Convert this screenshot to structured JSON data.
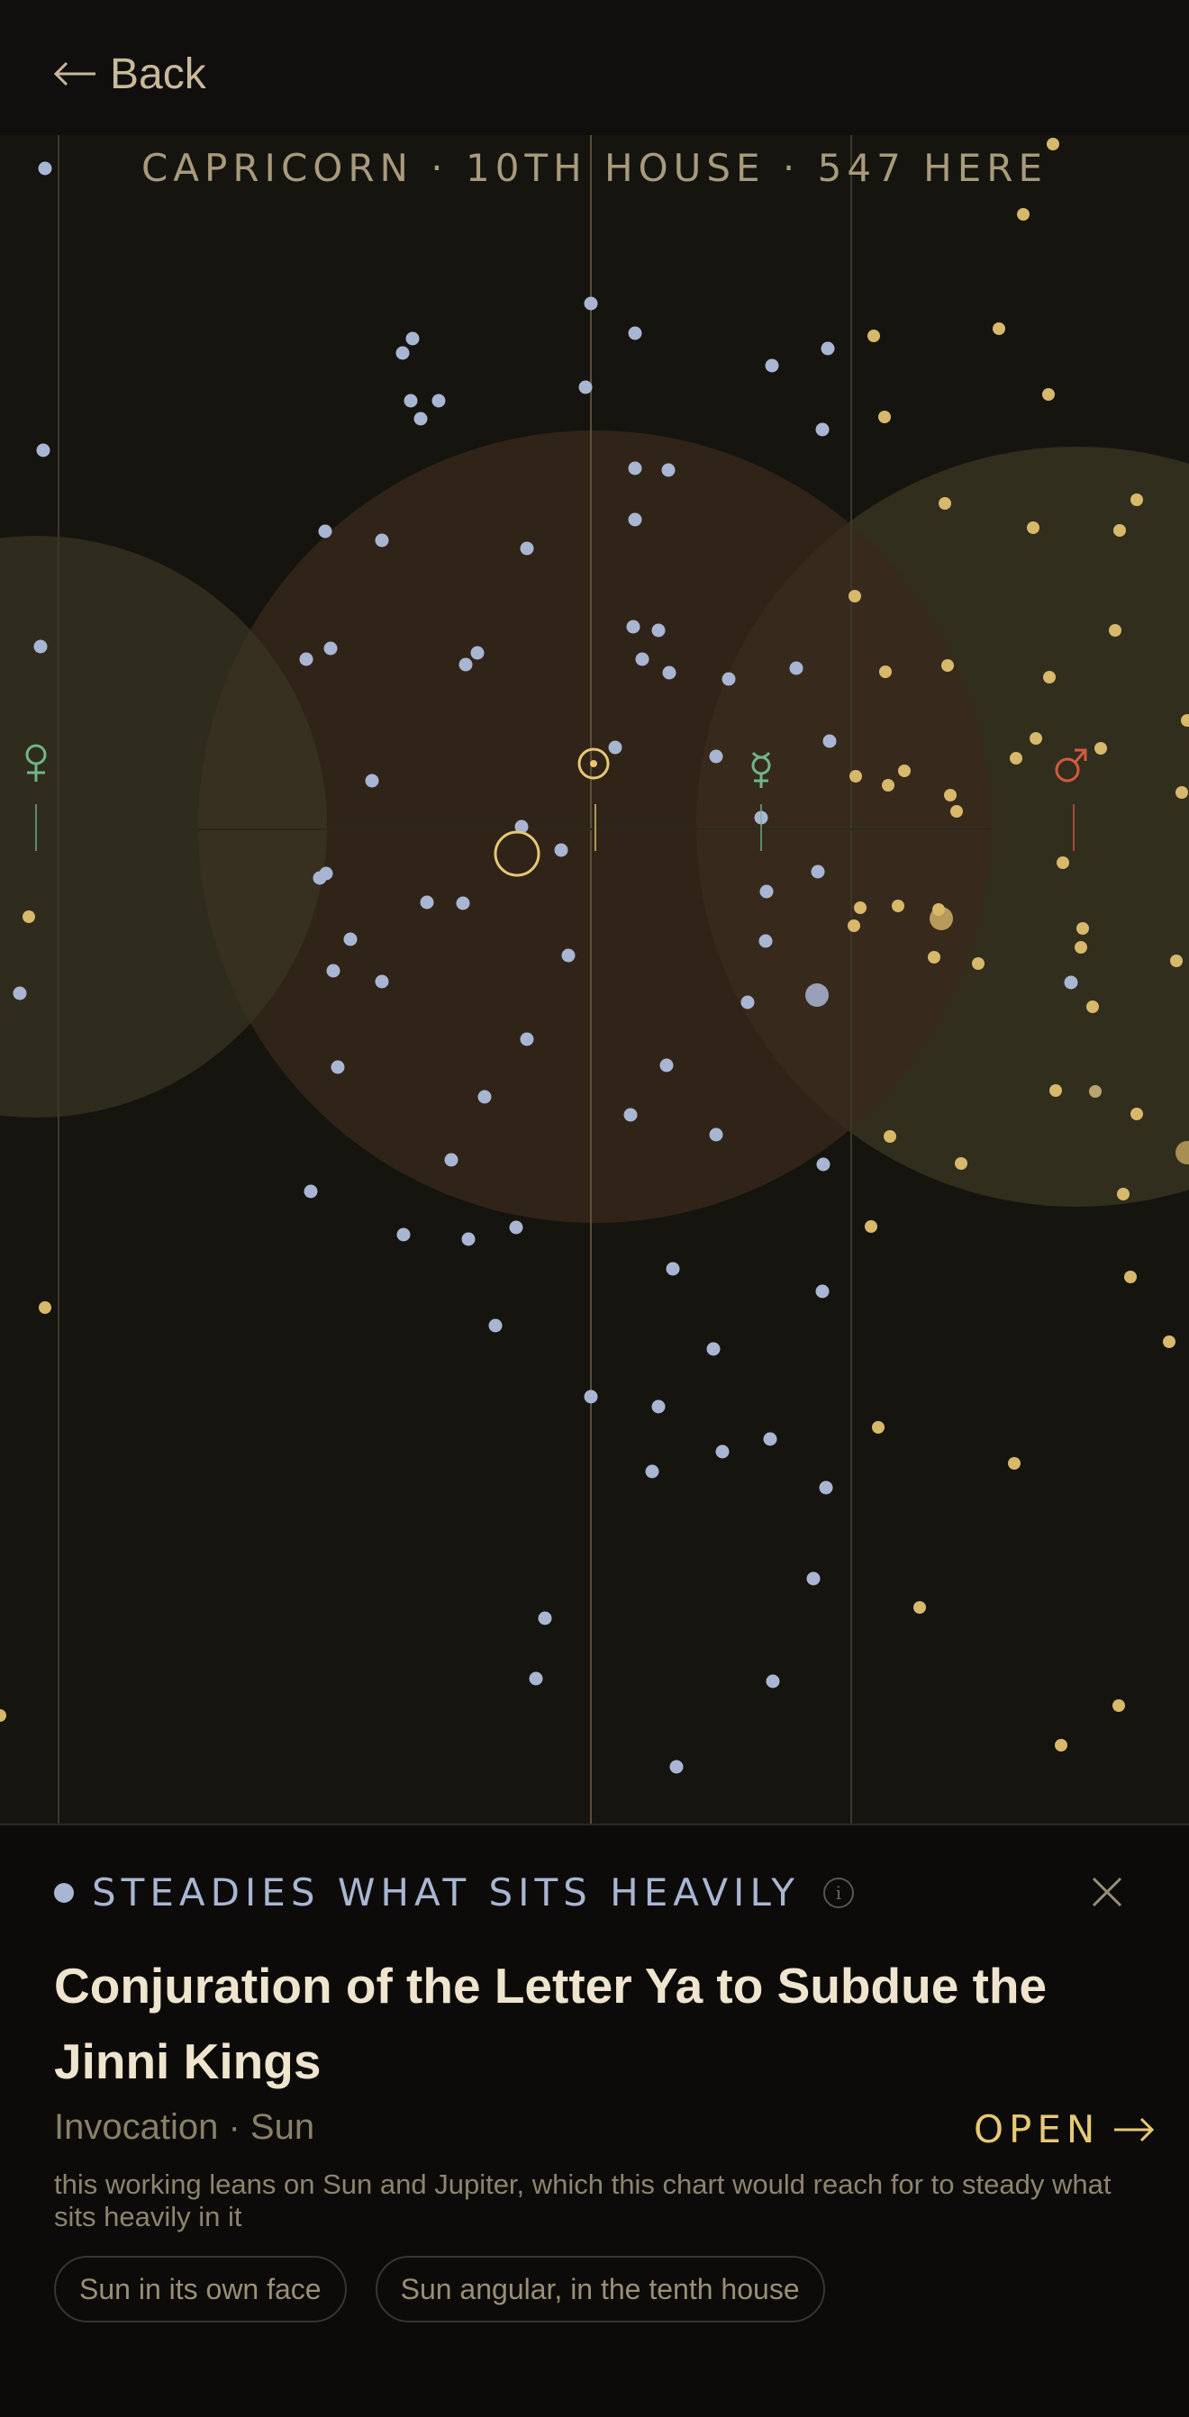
{
  "nav": {
    "back_label": "Back"
  },
  "location_label": "CAPRICORN · 10TH HOUSE · 547 HERE",
  "planets": [
    {
      "name": "venus-glyph",
      "glyph": "♀",
      "color": "#6fb58a"
    },
    {
      "name": "mercury-glyph",
      "glyph": "☿",
      "color": "#6fb58a"
    },
    {
      "name": "sun-glyph",
      "glyph": "☉",
      "color": "#e7c873"
    },
    {
      "name": "mars-glyph",
      "glyph": "♂",
      "color": "#d45a3f"
    }
  ],
  "colors": {
    "star_blue": "#a9b6d3",
    "star_gold": "#d8b86a",
    "accent_gold": "#e7c873",
    "title": "#efe4cd"
  },
  "card": {
    "verdict": "STEADIES WHAT SITS HEAVILY",
    "title": "Conjuration of the Letter Ya to Subdue the Jinni Kings",
    "subtitle": "Invocation · Sun",
    "open_label": "OPEN",
    "description": "this working leans on Sun and Jupiter, which this chart would reach for to steady what sits heavily in it",
    "chips": [
      "Sun in its own face",
      "Sun angular, in the tenth house"
    ]
  },
  "icons": {
    "back": "arrow-left-icon",
    "info": "info-icon",
    "close": "close-icon",
    "open": "arrow-right-icon"
  }
}
